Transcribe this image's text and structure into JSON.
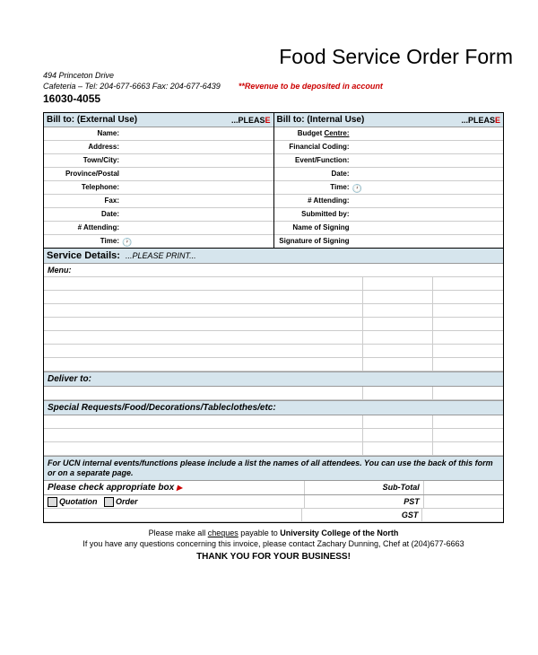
{
  "title": "Food Service Order Form",
  "addr_line1": "494 Princeton Drive",
  "addr_line2": "Cafeteria  –  Tel: 204-677-6663 Fax: 204-677-6439",
  "revenue_note": "**Revenue to be deposited in account",
  "acct": "16030-4055",
  "ext": {
    "hdr": "Bill to: (External Use)",
    "please": "...PLEAS",
    "e": "E",
    "fields": [
      "Name:",
      "Address:",
      "Town/City:",
      "Province/Postal",
      "Telephone:",
      "Fax:",
      "Date:",
      "# Attending:",
      "Time:"
    ]
  },
  "int": {
    "hdr": "Bill to: (Internal Use)",
    "please": "...PLEAS",
    "e": "E",
    "fields": [
      "Budget ",
      "Financial Coding:",
      "Event/Function:",
      "Date:",
      "Time:",
      "# Attending:",
      "Submitted by:",
      "Name of Signing",
      "Signature of Signing"
    ],
    "centre": "Centre:"
  },
  "svc": {
    "hdr": "Service Details:",
    "pp": "...PLEASE PRINT...",
    "menu": "Menu:"
  },
  "deliver": "Deliver to:",
  "requests": "Special Requests/Food/Decorations/Tableclothes/etc:",
  "note": "For UCN internal events/functions please include a list the names of all attendees. You can use the back of this form or on a separate page.",
  "checkbox": {
    "hdr": "Please check appropriate box",
    "tri": "▶",
    "q": "Quotation",
    "o": "Order"
  },
  "totals": {
    "sub": "Sub-Total",
    "pst": "PST",
    "gst": "GST"
  },
  "footer": {
    "l1a": "Please make all ",
    "l1b": "cheques",
    "l1c": " payable to ",
    "l1d": "University College of the North",
    "l2": "If you have any questions concerning this invoice, please contact Zachary Dunning, Chef at (204)677-6663",
    "ty": "THANK YOU FOR YOUR BUSINESS!"
  }
}
